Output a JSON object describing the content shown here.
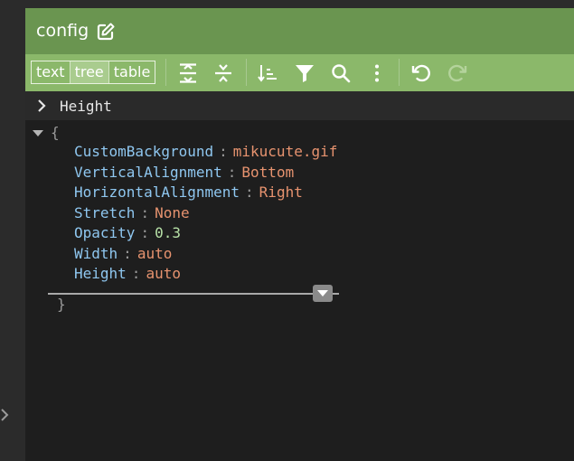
{
  "window": {
    "title": "config"
  },
  "toolbar": {
    "modes": [
      "text",
      "tree",
      "table"
    ],
    "active_mode": "tree"
  },
  "path": {
    "label": "Height"
  },
  "editor": {
    "open_brace": "{",
    "close_brace": "}",
    "rows": [
      {
        "key": "CustomBackground",
        "value": "mikucute.gif",
        "type": "string"
      },
      {
        "key": "VerticalAlignment",
        "value": "Bottom",
        "type": "string"
      },
      {
        "key": "HorizontalAlignment",
        "value": "Right",
        "type": "string"
      },
      {
        "key": "Stretch",
        "value": "None",
        "type": "string"
      },
      {
        "key": "Opacity",
        "value": "0.3",
        "type": "number"
      },
      {
        "key": "Width",
        "value": "auto",
        "type": "string"
      },
      {
        "key": "Height",
        "value": "auto",
        "type": "string"
      }
    ]
  },
  "colors": {
    "titlebar": "#6a9550",
    "toolbar": "#8bb86a",
    "key": "#8fc7f0",
    "string_value": "#e7936f",
    "number_value": "#b7e1a7"
  },
  "icons": [
    "edit-icon",
    "expand-all-icon",
    "collapse-all-icon",
    "sort-icon",
    "filter-icon",
    "search-icon",
    "more-icon",
    "undo-icon",
    "redo-icon",
    "chevron-right-icon",
    "caret-down-icon"
  ]
}
